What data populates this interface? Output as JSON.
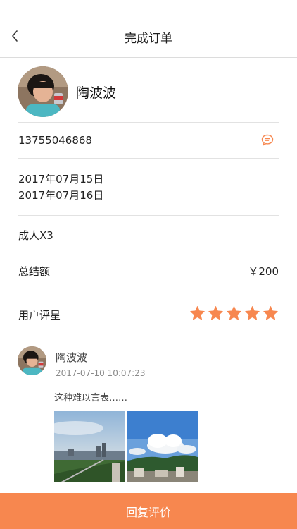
{
  "nav": {
    "title": "完成订单",
    "back_icon": "chevron-left-icon"
  },
  "customer": {
    "name": "陶波波",
    "phone": "13755046868",
    "message_icon": "chat-bubble-icon"
  },
  "order": {
    "check_in": "2017年07月15日",
    "check_out": "2017年07月16日",
    "guests": "成人X3",
    "total_label": "总结额",
    "total_value": "￥200"
  },
  "rating": {
    "label": "用户评星",
    "stars": 5,
    "max_stars": 5
  },
  "review": {
    "name": "陶波波",
    "time": "2017-07-10 10:07:23",
    "text": "这种难以言表……",
    "photo_count": 2
  },
  "footer": {
    "button_label": "回复评价"
  },
  "colors": {
    "accent": "#f7874f",
    "divider": "#e2e2e2",
    "text": "#222222"
  }
}
